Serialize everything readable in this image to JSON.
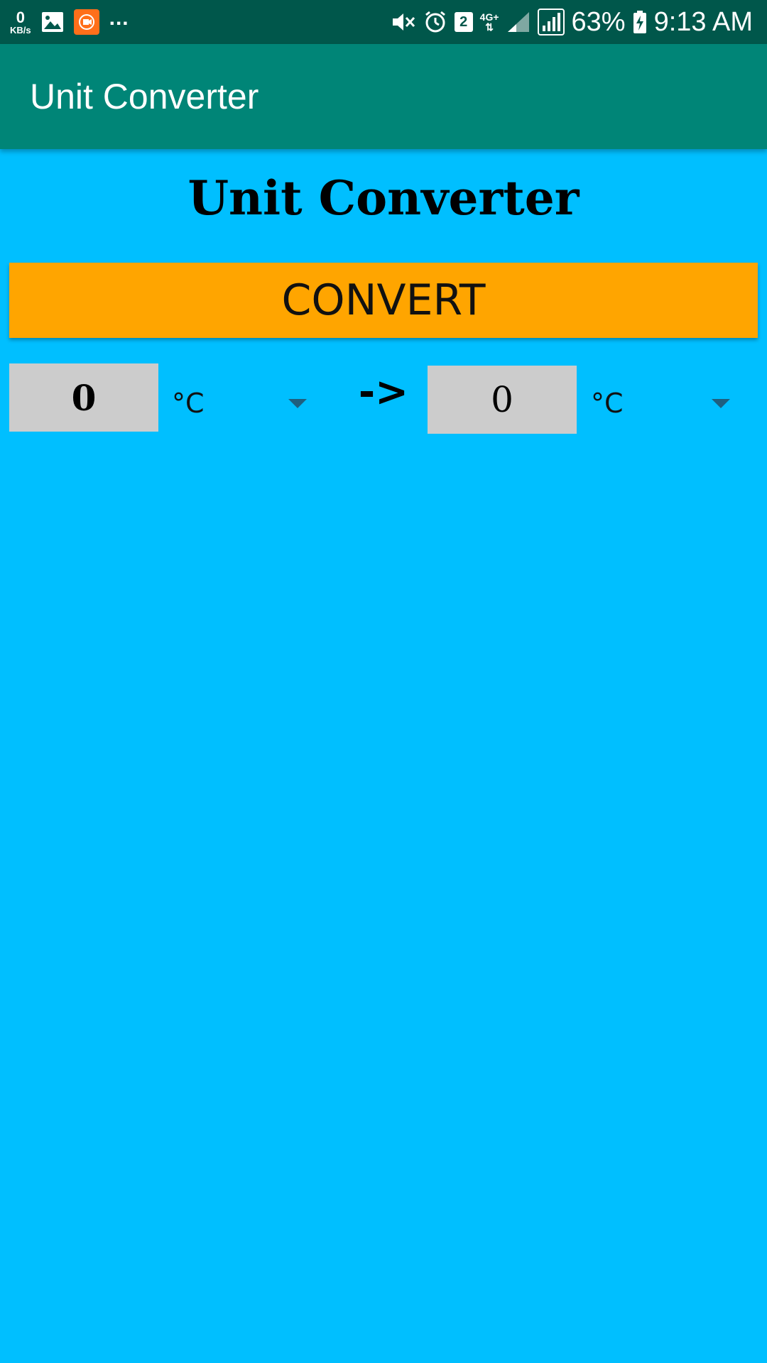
{
  "status_bar": {
    "speed_value": "0",
    "speed_unit": "KB/s",
    "more": "...",
    "sim_slot": "2",
    "network_type": "4G+",
    "battery_percent": "63%",
    "time": "9:13 AM",
    "icons": [
      "image-icon",
      "screen-recorder-icon",
      "mute-icon",
      "alarm-icon",
      "signal-icon",
      "battery-charging-icon"
    ]
  },
  "app_bar": {
    "title": "Unit Converter"
  },
  "main": {
    "heading": "Unit Converter",
    "convert_label": "CONVERT",
    "from_value": "0",
    "from_unit": "°C",
    "separator": "->",
    "to_value": "0",
    "to_unit": "°C"
  },
  "colors": {
    "background": "#00BFFF",
    "app_bar": "#008577",
    "status_bar": "#00574B",
    "convert_button": "#FFA500",
    "value_box": "#CCCCCC"
  }
}
